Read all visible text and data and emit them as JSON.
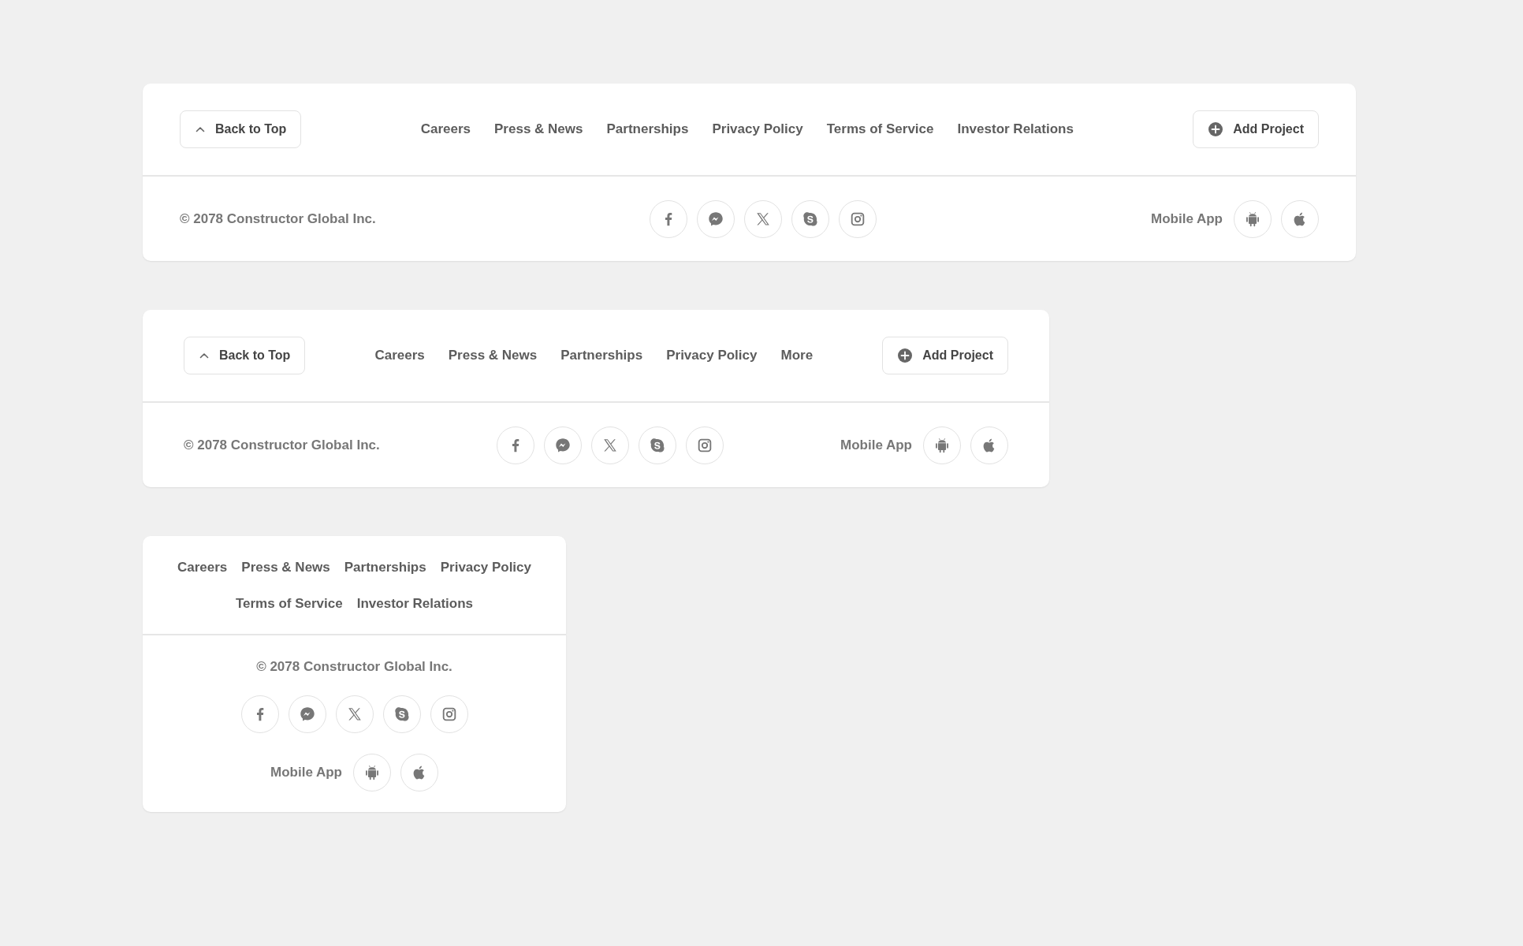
{
  "footers": [
    {
      "kind": "wide",
      "back_to_top": "Back to Top",
      "links": [
        "Careers",
        "Press & News",
        "Partnerships",
        "Privacy Policy",
        "Terms of Service",
        "Investor Relations"
      ],
      "add_project": "Add Project",
      "copyright": "© 2078 Constructor Global Inc.",
      "socials": [
        {
          "kind": "facebook"
        },
        {
          "kind": "messenger"
        },
        {
          "kind": "x"
        },
        {
          "kind": "skype"
        },
        {
          "kind": "instagram"
        }
      ],
      "mobile_app": "Mobile App",
      "stores": [
        {
          "kind": "android"
        },
        {
          "kind": "apple"
        }
      ]
    },
    {
      "kind": "medium",
      "back_to_top": "Back to Top",
      "links": [
        "Careers",
        "Press & News",
        "Partnerships",
        "Privacy Policy",
        "More"
      ],
      "add_project": "Add Project",
      "copyright": "© 2078 Constructor Global Inc.",
      "socials": [
        {
          "kind": "facebook"
        },
        {
          "kind": "messenger"
        },
        {
          "kind": "x"
        },
        {
          "kind": "skype"
        },
        {
          "kind": "instagram"
        }
      ],
      "mobile_app": "Mobile App",
      "stores": [
        {
          "kind": "android"
        },
        {
          "kind": "apple"
        }
      ]
    },
    {
      "kind": "compact",
      "links": [
        "Careers",
        "Press & News",
        "Partnerships",
        "Privacy Policy",
        "Terms of Service",
        "Investor Relations"
      ],
      "copyright": "© 2078 Constructor Global Inc.",
      "socials": [
        {
          "kind": "facebook"
        },
        {
          "kind": "messenger"
        },
        {
          "kind": "x"
        },
        {
          "kind": "skype"
        },
        {
          "kind": "instagram"
        }
      ],
      "mobile_app": "Mobile App",
      "stores": [
        {
          "kind": "android"
        },
        {
          "kind": "apple"
        }
      ]
    }
  ]
}
